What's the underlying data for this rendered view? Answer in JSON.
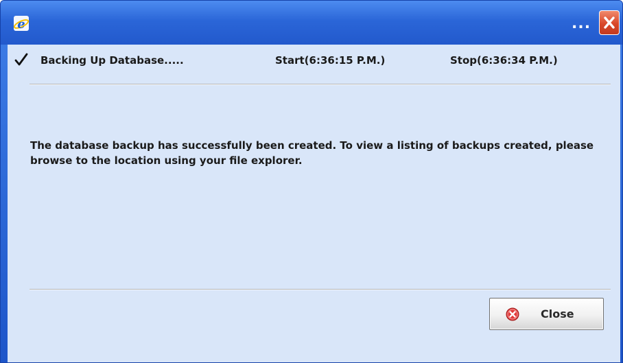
{
  "window": {
    "title_overflow": "...",
    "icons": {
      "app": "internet-explorer-icon",
      "close": "close-icon"
    },
    "colors": {
      "titlebar": "#2b66d8",
      "client": "#d9e6f9",
      "close_button": "#d9482a"
    }
  },
  "status": {
    "task": "Backing Up Database.....",
    "start": "Start(6:36:15 P.M.)",
    "stop": "Stop(6:36:34 P.M.)",
    "icon": "checkmark-icon"
  },
  "message": "The database backup has successfully been created. To view a listing of backups created, please browse to the location using your file explorer.",
  "footer": {
    "close_label": "Close",
    "close_icon": "cancel-icon"
  }
}
